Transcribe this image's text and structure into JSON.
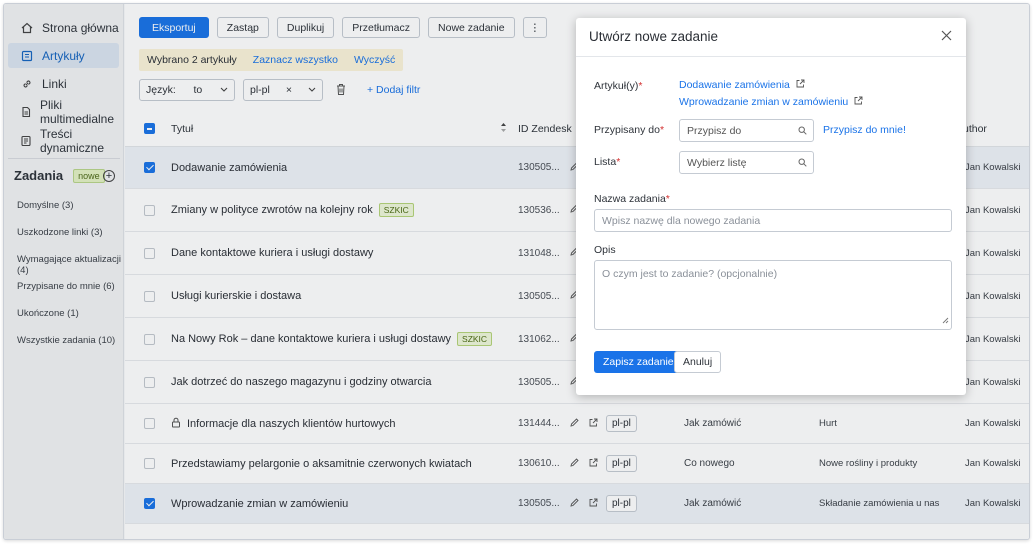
{
  "sidebar": {
    "nav": [
      {
        "label": "Strona główna",
        "icon": "home-icon"
      },
      {
        "label": "Artykuły",
        "icon": "article-icon",
        "active": true
      },
      {
        "label": "Linki",
        "icon": "link-icon"
      },
      {
        "label": "Pliki multimedialne",
        "icon": "file-icon"
      },
      {
        "label": "Treści dynamiczne",
        "icon": "dynamic-content-icon"
      }
    ],
    "tasks_title": "Zadania",
    "tasks_badge": "nowe",
    "task_links": [
      "Domyślne (3)",
      "Uszkodzone linki (3)",
      "Wymagające aktualizacji (4)",
      "Przypisane do mnie (6)",
      "Ukończone (1)",
      "Wszystkie zadania (10)"
    ]
  },
  "toolbar": {
    "export": "Eksportuj",
    "replace": "Zastąp",
    "duplicate": "Duplikuj",
    "translate": "Przetłumacz",
    "new_task": "Nowe zadanie",
    "more": "⋮"
  },
  "selection": {
    "selected_text": "Wybrano 2 artykuły",
    "select_all": "Zaznacz wszystko",
    "clear": "Wyczyść"
  },
  "filters": {
    "language_label": "Język:",
    "operator": "to",
    "value": "pl-pl",
    "clear_x": "×",
    "add_filter": "+ Dodaj filtr"
  },
  "table": {
    "columns": {
      "title": "Tytuł",
      "id": "ID Zendesk",
      "author": "uthor"
    },
    "rows": [
      {
        "title": "Dodawanie zamówienia",
        "id": "130505...",
        "checked": true,
        "draft": "",
        "lang": "",
        "list": "",
        "category": "",
        "author": "Jan Kowalski",
        "lock": false
      },
      {
        "title": "Zmiany w polityce zwrotów na kolejny rok",
        "id": "130536...",
        "checked": false,
        "draft": "SZKIC",
        "lang": "",
        "list": "",
        "category": "",
        "author": "Jan Kowalski",
        "lock": false
      },
      {
        "title": "Dane kontaktowe kuriera i usługi dostawy",
        "id": "131048...",
        "checked": false,
        "draft": "",
        "lang": "",
        "list": "",
        "category": "",
        "author": "Jan Kowalski",
        "lock": false
      },
      {
        "title": "Usługi kurierskie i dostawa",
        "id": "130505...",
        "checked": false,
        "draft": "",
        "lang": "",
        "list": "",
        "category": "",
        "author": "Jan Kowalski",
        "lock": false
      },
      {
        "title": "Na Nowy Rok – dane kontaktowe kuriera i usługi dostawy",
        "id": "131062...",
        "checked": false,
        "draft": "SZKIC",
        "lang": "",
        "list": "",
        "category": "",
        "author": "Jan Kowalski",
        "lock": false
      },
      {
        "title": "Jak dotrzeć do naszego magazynu i godziny otwarcia",
        "id": "130505...",
        "checked": false,
        "draft": "",
        "lang": "",
        "list": "",
        "category": "",
        "author": "Jan Kowalski",
        "lock": false
      },
      {
        "title": "Informacje dla naszych klientów hurtowych",
        "id": "131444...",
        "checked": false,
        "draft": "",
        "lang": "pl-pl",
        "list": "Jak zamówić",
        "category": "Hurt",
        "author": "Jan Kowalski",
        "lock": true
      },
      {
        "title": "Przedstawiamy pelargonie o aksamitnie czerwonych kwiatach",
        "id": "130610...",
        "checked": false,
        "draft": "",
        "lang": "pl-pl",
        "list": "Co nowego",
        "category": "Nowe rośliny i produkty",
        "author": "Jan Kowalski",
        "lock": false
      },
      {
        "title": "Wprowadzanie zmian w zamówieniu",
        "id": "130505...",
        "checked": true,
        "draft": "",
        "lang": "pl-pl",
        "list": "Jak zamówić",
        "category": "Składanie zamówienia u nas",
        "author": "Jan Kowalski",
        "lock": false
      }
    ]
  },
  "modal": {
    "title": "Utwórz nowe zadanie",
    "articles_label": "Artykuł(y)",
    "articles": [
      "Dodawanie zamówienia",
      "Wprowadzanie zmian w zamówieniu"
    ],
    "assigned_label": "Przypisany do",
    "assigned_placeholder": "Przypisz do",
    "assign_me": "Przypisz do mnie!",
    "list_label": "Lista",
    "list_placeholder": "Wybierz listę",
    "task_name_label": "Nazwa zadania",
    "task_name_placeholder": "Wpisz nazwę dla nowego zadania",
    "desc_label": "Opis",
    "desc_placeholder": "O czym jest to zadanie? (opcjonalnie)",
    "save": "Zapisz zadanie",
    "cancel": "Anuluj",
    "required_mark": "*"
  },
  "colors": {
    "accent": "#1a73e8",
    "required": "#d32f2f",
    "selection_bg": "#fbf4d9"
  }
}
